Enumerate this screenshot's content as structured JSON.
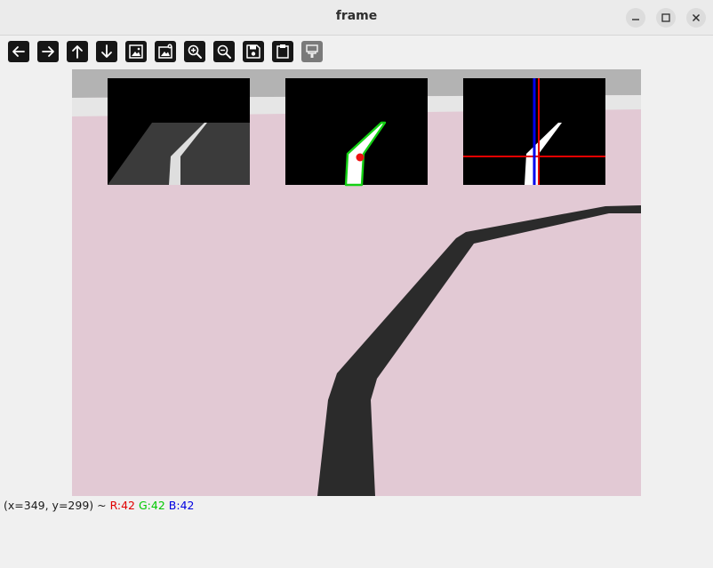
{
  "window": {
    "title": "frame",
    "controls": {
      "minimize": "minimize-icon",
      "maximize": "maximize-icon",
      "close": "close-icon"
    }
  },
  "toolbar": {
    "buttons": [
      {
        "icon": "arrow-left-icon",
        "action": "pan-left"
      },
      {
        "icon": "arrow-right-icon",
        "action": "pan-right"
      },
      {
        "icon": "arrow-up-icon",
        "action": "pan-up"
      },
      {
        "icon": "arrow-down-icon",
        "action": "pan-down"
      },
      {
        "icon": "zoom-original-icon",
        "action": "zoom-original"
      },
      {
        "icon": "zoom-fit-icon",
        "action": "zoom-fit"
      },
      {
        "icon": "zoom-in-icon",
        "action": "zoom-in"
      },
      {
        "icon": "zoom-out-icon",
        "action": "zoom-out"
      },
      {
        "icon": "save-icon",
        "action": "save"
      },
      {
        "icon": "clipboard-icon",
        "action": "copy"
      },
      {
        "icon": "properties-icon",
        "action": "properties",
        "enabled": false
      }
    ]
  },
  "image": {
    "colors": {
      "floor": "#e2c9d4",
      "wall_top": "#b3b3b3",
      "wall_band": "#e6e6e6",
      "road": "#2b2b2b",
      "mask_outline": "#14d014",
      "centroid": "#ee1111",
      "red_line": "#e60000",
      "blue_line": "#0000ee"
    }
  },
  "status": {
    "coords": "(x=349, y=299) ~ ",
    "r": "R:42",
    "g": "G:42",
    "b": "B:42",
    "colors": {
      "r": "#e00000",
      "g": "#00c800",
      "b": "#0000e0"
    }
  }
}
